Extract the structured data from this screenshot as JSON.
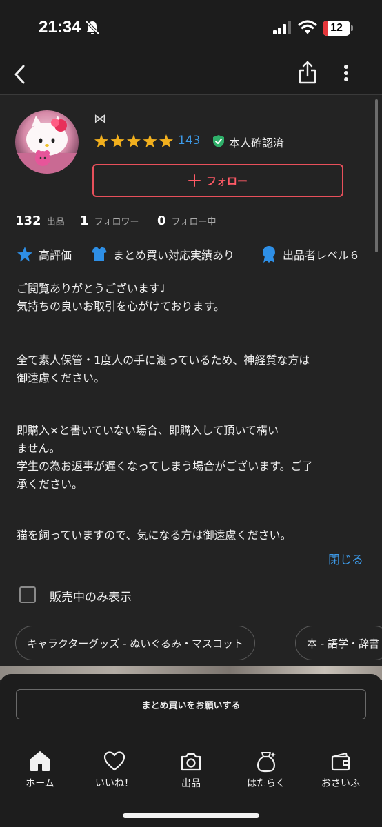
{
  "status_bar": {
    "time": "21:34",
    "battery": "12"
  },
  "profile": {
    "name": "⋈",
    "rating_stars": 5,
    "review_count": "143",
    "verified_label": "本人確認済",
    "follow_label": "フォロー"
  },
  "stats": [
    {
      "value": "132",
      "label": "出品"
    },
    {
      "value": "1",
      "label": "フォロワー"
    },
    {
      "value": "0",
      "label": "フォロー中"
    }
  ],
  "badges": [
    {
      "label": "高評価",
      "icon": "star-icon"
    },
    {
      "label": "まとめ買い対応実績あり",
      "icon": "shirt-icon"
    },
    {
      "label": "出品者レベル６",
      "icon": "medal-icon"
    }
  ],
  "bio": {
    "p1": "ご閲覧ありがとうございます♩\n気持ちの良いお取引を心がけております。",
    "p2": "全て素人保管・1度人の手に渡っているため、神経質な方は\n御遠慮ください。",
    "p3": "即購入×と書いていない場合、即購入して頂いて構い\nません。\n学生の為お返事が遅くなってしまう場合がございます。ご了\n承ください。",
    "p4": "猫を飼っていますので、気になる方は御遠慮ください。"
  },
  "close_label": "閉じる",
  "filter": {
    "label": "販売中のみ表示",
    "checked": false
  },
  "categories": [
    "キャラクターグッズ - ぬいぐるみ・マスコット",
    "本 - 語学・辞書"
  ],
  "bulk_request_label": "まとめ買いをお願いする",
  "tabs": [
    {
      "label": "ホーム",
      "icon": "home-icon"
    },
    {
      "label": "いいね！",
      "icon": "heart-icon"
    },
    {
      "label": "出品",
      "icon": "camera-icon"
    },
    {
      "label": "はたらく",
      "icon": "money-bag-icon"
    },
    {
      "label": "おさいふ",
      "icon": "wallet-icon"
    }
  ],
  "colors": {
    "accent_red": "#e8505b",
    "link_blue": "#3d9ae8",
    "star_yellow": "#f2b01e",
    "verified_green": "#2fb06a"
  }
}
